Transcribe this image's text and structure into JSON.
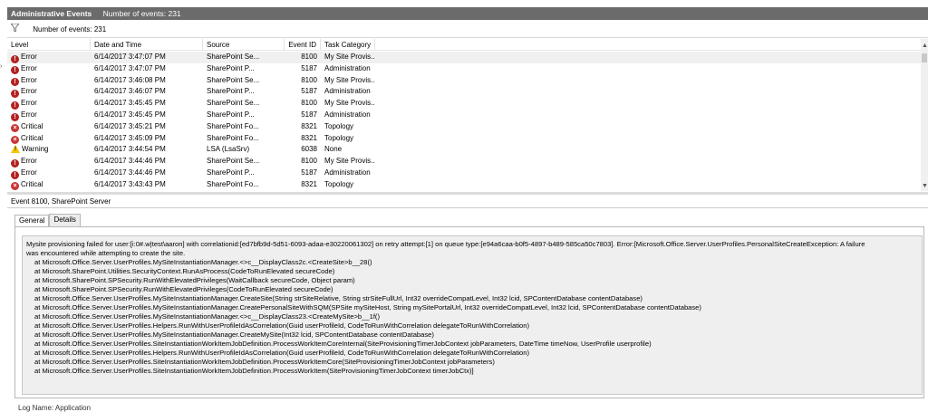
{
  "header": {
    "title": "Administrative Events",
    "count_text": "Number of events: 231"
  },
  "filter": {
    "icon": "filter-icon",
    "text": "Number of events: 231"
  },
  "columns": [
    "Level",
    "Date and Time",
    "Source",
    "Event ID",
    "Task Category"
  ],
  "rows": [
    {
      "level": "Error",
      "icon": "error-icon",
      "date": "6/14/2017 3:47:07 PM",
      "source": "SharePoint Se...",
      "id": "8100",
      "category": "My Site Provis..."
    },
    {
      "level": "Error",
      "icon": "error-icon",
      "date": "6/14/2017 3:47:07 PM",
      "source": "SharePoint P...",
      "id": "5187",
      "category": "Administration"
    },
    {
      "level": "Error",
      "icon": "error-icon",
      "date": "6/14/2017 3:46:08 PM",
      "source": "SharePoint Se...",
      "id": "8100",
      "category": "My Site Provis..."
    },
    {
      "level": "Error",
      "icon": "error-icon",
      "date": "6/14/2017 3:46:07 PM",
      "source": "SharePoint P...",
      "id": "5187",
      "category": "Administration"
    },
    {
      "level": "Error",
      "icon": "error-icon",
      "date": "6/14/2017 3:45:45 PM",
      "source": "SharePoint Se...",
      "id": "8100",
      "category": "My Site Provis..."
    },
    {
      "level": "Error",
      "icon": "error-icon",
      "date": "6/14/2017 3:45:45 PM",
      "source": "SharePoint P...",
      "id": "5187",
      "category": "Administration"
    },
    {
      "level": "Critical",
      "icon": "critical-icon",
      "date": "6/14/2017 3:45:21 PM",
      "source": "SharePoint Fo...",
      "id": "8321",
      "category": "Topology"
    },
    {
      "level": "Critical",
      "icon": "critical-icon",
      "date": "6/14/2017 3:45:09 PM",
      "source": "SharePoint Fo...",
      "id": "8321",
      "category": "Topology"
    },
    {
      "level": "Warning",
      "icon": "warning-icon",
      "date": "6/14/2017 3:44:54 PM",
      "source": "LSA (LsaSrv)",
      "id": "6038",
      "category": "None"
    },
    {
      "level": "Error",
      "icon": "error-icon",
      "date": "6/14/2017 3:44:46 PM",
      "source": "SharePoint Se...",
      "id": "8100",
      "category": "My Site Provis..."
    },
    {
      "level": "Error",
      "icon": "error-icon",
      "date": "6/14/2017 3:44:46 PM",
      "source": "SharePoint P...",
      "id": "5187",
      "category": "Administration"
    },
    {
      "level": "Critical",
      "icon": "critical-icon",
      "date": "6/14/2017 3:43:43 PM",
      "source": "SharePoint Fo...",
      "id": "8321",
      "category": "Topology"
    }
  ],
  "detail": {
    "heading": "Event 8100, SharePoint Server",
    "tabs": [
      "General",
      "Details"
    ],
    "message_lines": [
      "Mysite provisioning failed for user:[i:0#.w|test\\aaron] with correlationid:[ed7bfb9d-5d51-6093-adaa-e30220061302] on retry attempt:[1] on queue type:[e94a6caa-b0f5-4897-b489-585ca50c7803]. Error:[Microsoft.Office.Server.UserProfiles.PersonalSiteCreateException: A failure",
      "was encountered while attempting to create the site.",
      "at Microsoft.Office.Server.UserProfiles.MySiteInstantiationManager.<>c__DisplayClass2c.<CreateSite>b__28()",
      "at Microsoft.SharePoint.Utilities.SecurityContext.RunAsProcess(CodeToRunElevated secureCode)",
      "at Microsoft.SharePoint.SPSecurity.RunWithElevatedPrivileges(WaitCallback secureCode, Object param)",
      "at Microsoft.SharePoint.SPSecurity.RunWithElevatedPrivileges(CodeToRunElevated secureCode)",
      "at Microsoft.Office.Server.UserProfiles.MySiteInstantiationManager.CreateSite(String strSiteRelative, String strSiteFullUrl, Int32 overrideCompatLevel, Int32 lcid, SPContentDatabase contentDatabase)",
      "at Microsoft.Office.Server.UserProfiles.MySiteInstantiationManager.CreatePersonalSiteWithSQM(SPSite mySiteHost, String mySitePortalUrl, Int32 overrideCompatLevel, Int32 lcid, SPContentDatabase contentDatabase)",
      "at Microsoft.Office.Server.UserProfiles.MySiteInstantiationManager.<>c__DisplayClass23.<CreateMySite>b__1f()",
      "at Microsoft.Office.Server.UserProfiles.Helpers.RunWithUserProfileIdAsCorrelation(Guid userProfileId, CodeToRunWithCorrelation delegateToRunWithCorrelation)",
      "at Microsoft.Office.Server.UserProfiles.MySiteInstantiationManager.CreateMySite(Int32 lcid, SPContentDatabase contentDatabase)",
      "at Microsoft.Office.Server.UserProfiles.SiteInstantiationWorkItemJobDefinition.ProcessWorkItemCoreInternal(SiteProvisioningTimerJobContext jobParameters, DateTime timeNow, UserProfile userprofile)",
      "at Microsoft.Office.Server.UserProfiles.Helpers.RunWithUserProfileIdAsCorrelation(Guid userProfileId, CodeToRunWithCorrelation delegateToRunWithCorrelation)",
      "at Microsoft.Office.Server.UserProfiles.SiteInstantiationWorkItemJobDefinition.ProcessWorkItemCore(SiteProvisioningTimerJobContext jobParameters)",
      "at Microsoft.Office.Server.UserProfiles.SiteInstantiationWorkItemJobDefinition.ProcessWorkItem(SiteProvisioningTimerJobContext timerJobCtx)]"
    ],
    "bottom_cut_text": "Log Name:        Application"
  },
  "colors": {
    "titlebar_bg": "#6b6b6b",
    "error": "#b32121",
    "critical": "#c83535",
    "warning": "#f3c600",
    "selected_row": "#f0f0f0",
    "message_bg": "#efefef"
  }
}
